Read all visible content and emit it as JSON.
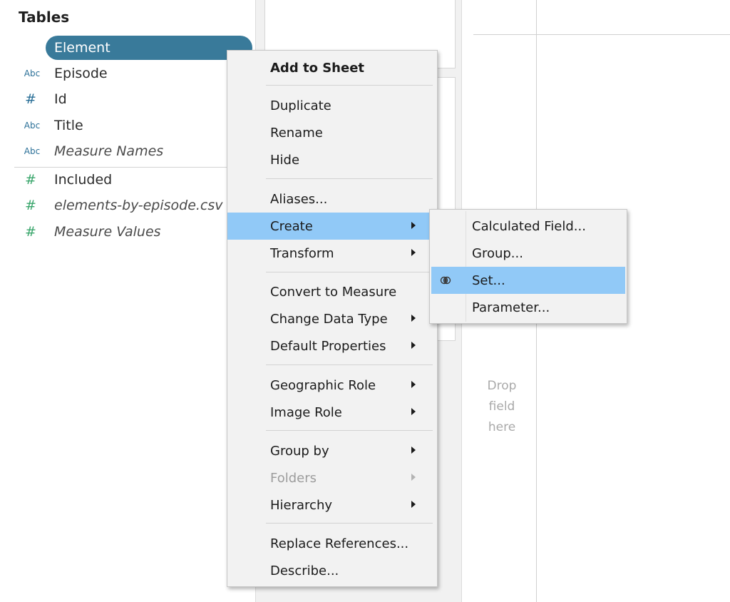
{
  "data_pane": {
    "header": "Tables",
    "fields": [
      {
        "type_icon": "Abc",
        "label": "Element",
        "selected": true
      },
      {
        "type_icon": "Abc",
        "label": "Episode"
      },
      {
        "type_icon": "#",
        "label": "Id"
      },
      {
        "type_icon": "Abc",
        "label": "Title"
      },
      {
        "type_icon": "Abc",
        "label": "Measure Names"
      },
      {
        "type_icon": "#",
        "label": "Included"
      },
      {
        "type_icon": "#",
        "label": "elements-by-episode.csv"
      },
      {
        "type_icon": "#",
        "label": "Measure Values"
      }
    ]
  },
  "view": {
    "drop_field_text_1": "Drop",
    "drop_field_text_2": "field",
    "drop_field_text_3": "here"
  },
  "context_menu": {
    "add_to_sheet": "Add to Sheet",
    "duplicate": "Duplicate",
    "rename": "Rename",
    "hide": "Hide",
    "aliases": "Aliases...",
    "create": "Create",
    "transform": "Transform",
    "convert_to_measure": "Convert to Measure",
    "change_data_type": "Change Data Type",
    "default_properties": "Default Properties",
    "geographic_role": "Geographic Role",
    "image_role": "Image Role",
    "group_by": "Group by",
    "folders": "Folders",
    "hierarchy": "Hierarchy",
    "replace_references": "Replace References...",
    "describe": "Describe..."
  },
  "create_submenu": {
    "calculated_field": "Calculated Field...",
    "group": "Group...",
    "set": "Set...",
    "parameter": "Parameter..."
  },
  "colors": {
    "dimension_icon": "#2a6f97",
    "measure_icon": "#3aa66c",
    "selected_pill": "#397a9a",
    "menu_highlight": "#91c9f7"
  }
}
